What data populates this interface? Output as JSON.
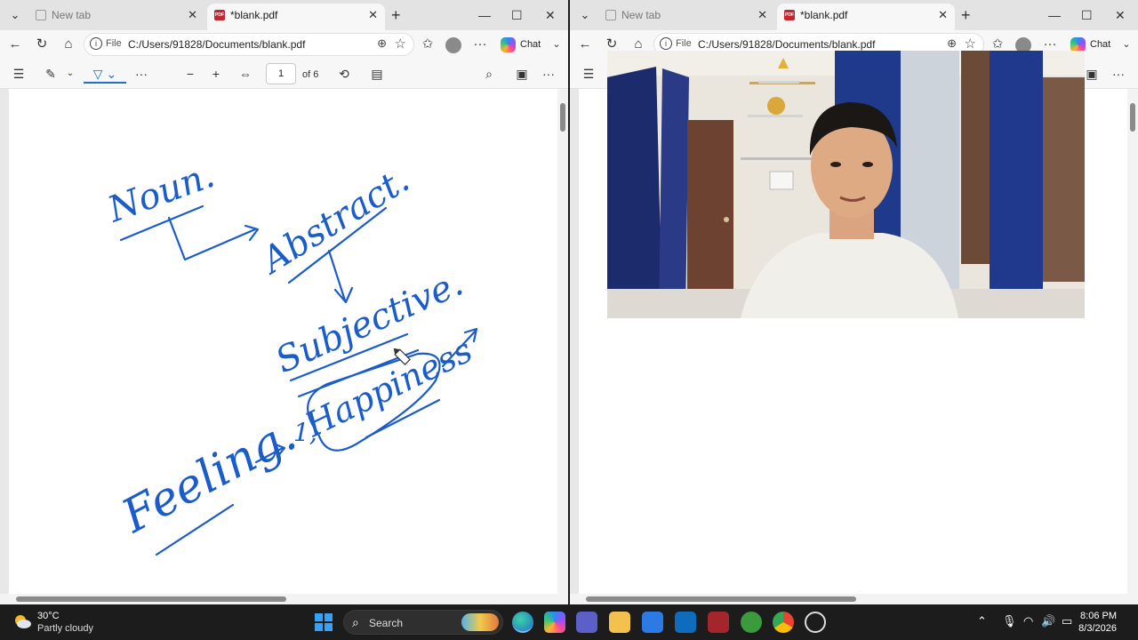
{
  "browser": {
    "tabs": [
      {
        "title": "New tab"
      },
      {
        "title": "*blank.pdf"
      }
    ],
    "address": {
      "scheme_label": "File",
      "url": "C:/Users/91828/Documents/blank.pdf"
    },
    "chat_label": "Chat"
  },
  "pdf_toolbar": {
    "page_number": "1",
    "page_count_label": "of 6"
  },
  "handwriting": {
    "noun": "Noun.",
    "abstract": "Abstract.",
    "subjective": "Subjective.",
    "happiness": "Happiness",
    "feeling": "Feeling.",
    "list_marker": "1,",
    "ink_color": "#1a5cc8"
  },
  "taskbar": {
    "weather_temp": "30°C",
    "weather_desc": "Partly cloudy",
    "search_label": "Search",
    "time": "8:06 PM",
    "date": "8/3/2026"
  }
}
